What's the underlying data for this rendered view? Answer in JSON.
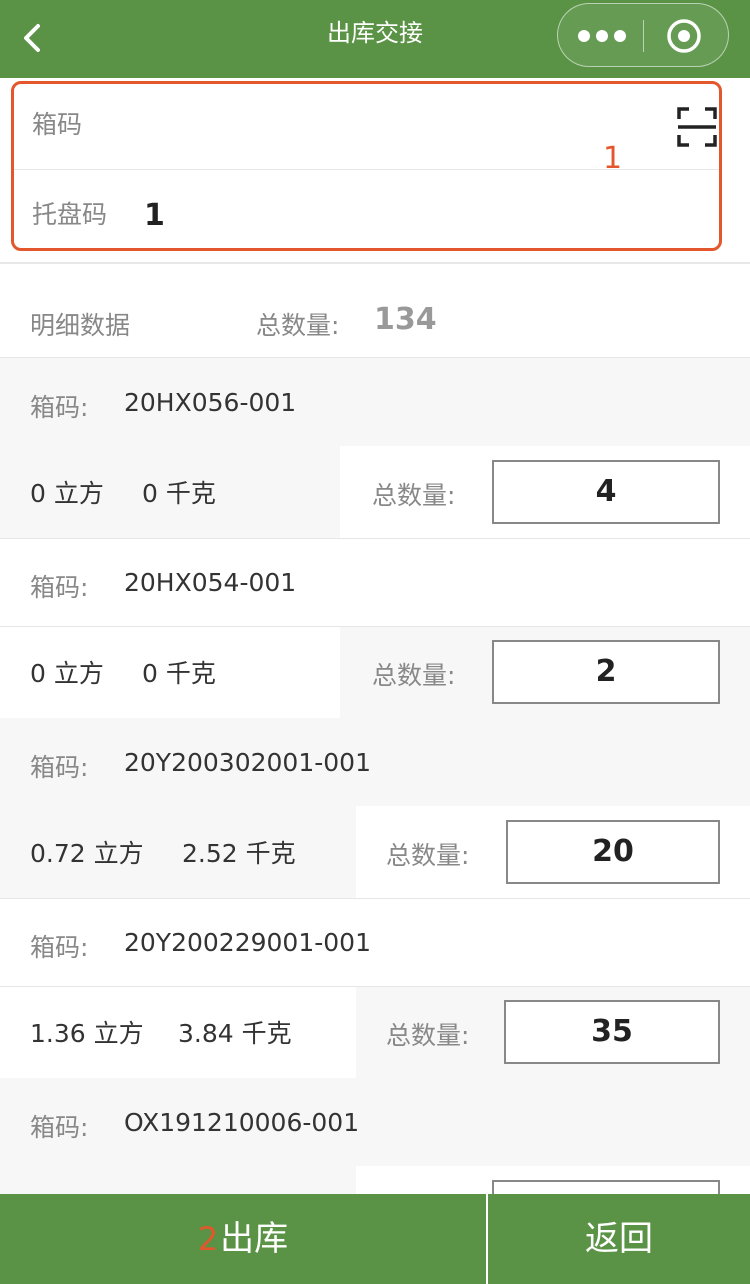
{
  "nav": {
    "title": "出库交接"
  },
  "scan": {
    "box_code_label": "箱码",
    "box_code_value": "",
    "pallet_label": "托盘码",
    "pallet_value": "1",
    "annotation": "1"
  },
  "summary": {
    "label": "明细数据",
    "total_label": "总数量:",
    "total_value": "134"
  },
  "items": [
    {
      "code_label": "箱码:",
      "code": "20HX056-001",
      "volume": "0 立方",
      "weight": "0 千克",
      "qty_label": "总数量:",
      "qty": "4"
    },
    {
      "code_label": "箱码:",
      "code": "20HX054-001",
      "volume": "0 立方",
      "weight": "0 千克",
      "qty_label": "总数量:",
      "qty": "2"
    },
    {
      "code_label": "箱码:",
      "code": "20Y200302001-001",
      "volume": "0.72 立方",
      "weight": "2.52 千克",
      "qty_label": "总数量:",
      "qty": "20"
    },
    {
      "code_label": "箱码:",
      "code": "20Y200229001-001",
      "volume": "1.36 立方",
      "weight": "3.84 千克",
      "qty_label": "总数量:",
      "qty": "35"
    },
    {
      "code_label": "箱码:",
      "code": "OX191210006-001",
      "volume": "",
      "weight": "",
      "qty_label": "",
      "qty": ""
    }
  ],
  "bottom": {
    "annotation": "2",
    "outbound_label": "出库",
    "back_label": "返回"
  },
  "colors": {
    "primary": "#5a9345",
    "annotation": "#e4572c"
  }
}
